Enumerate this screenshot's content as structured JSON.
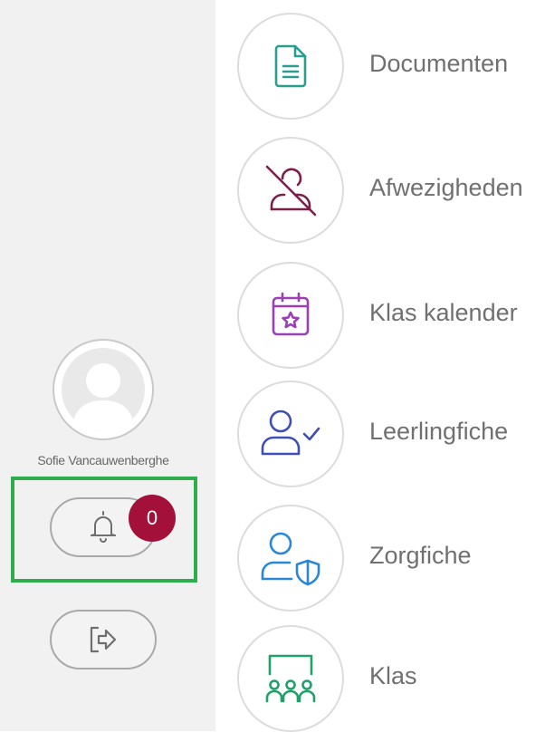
{
  "user": {
    "name": "Sofie Vancauwenberghe",
    "avatar_icon": "user-silhouette-icon"
  },
  "notifications": {
    "icon": "bell-icon",
    "count": "0",
    "badge_color": "#a3113b",
    "highlight_color": "#2fad4e"
  },
  "logout": {
    "icon": "logout-arrow-icon"
  },
  "menu": {
    "items": [
      {
        "label": "Documenten",
        "icon": "document-icon",
        "color": "#2a9d8f"
      },
      {
        "label": "Afwezigheden",
        "icon": "absent-person-icon",
        "color": "#7a1f4a"
      },
      {
        "label": "Klas kalender",
        "icon": "calendar-star-icon",
        "color": "#9b3fb6"
      },
      {
        "label": "Leerlingfiche",
        "icon": "person-check-icon",
        "color": "#3f4fb4"
      },
      {
        "label": "Zorgfiche",
        "icon": "person-shield-icon",
        "color": "#2a86d6"
      },
      {
        "label": "Klas",
        "icon": "classroom-icon",
        "color": "#21a06a"
      }
    ]
  }
}
